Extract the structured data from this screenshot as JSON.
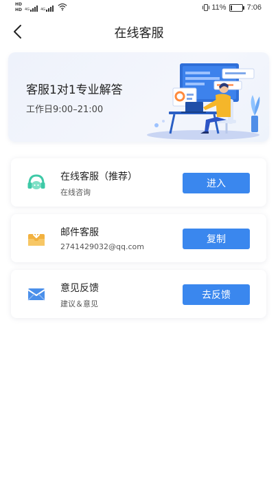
{
  "status_bar": {
    "sim1": "HD",
    "sim2": "HD",
    "net1": "4G",
    "net2": "4G",
    "battery": "11%",
    "battery_fraction": 0.11,
    "time": "7:06"
  },
  "nav": {
    "back_icon": "chevron-left-icon",
    "title": "在线客服"
  },
  "banner": {
    "title": "客服1对1专业解答",
    "hours": "工作日9:00–21:00"
  },
  "services": [
    {
      "title": "在线客服（推荐）",
      "subtitle": "在线咨询",
      "button": "进入",
      "icon": "headset-icon",
      "icon_color": "#3ec9a7"
    },
    {
      "title": "邮件客服",
      "subtitle": "2741429032@qq.com",
      "button": "复制",
      "icon": "mail-inbox-icon",
      "icon_color": "#f2b13f"
    },
    {
      "title": "意见反馈",
      "subtitle": "建议＆意见",
      "button": "去反馈",
      "icon": "envelope-icon",
      "icon_color": "#4a8fea"
    }
  ],
  "colors": {
    "accent": "#3a87ee",
    "banner_bg": "#eef2fb",
    "text_primary": "#222222"
  }
}
